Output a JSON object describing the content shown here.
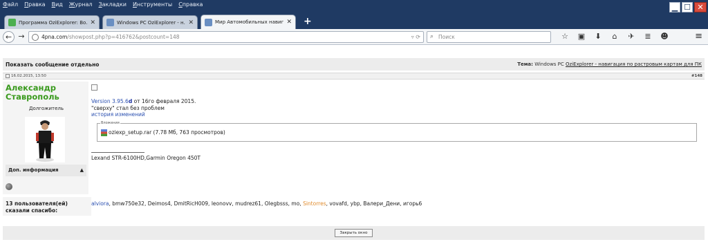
{
  "menubar": {
    "items": [
      "Файл",
      "Правка",
      "Вид",
      "Журнал",
      "Закладки",
      "Инструменты",
      "Справка"
    ]
  },
  "window_controls": {
    "minimize": "▁",
    "maximize": "☐",
    "close": "✕"
  },
  "tabs": [
    {
      "label": "Программа OziExplorer: Во...",
      "favicon_color": "#4caf50",
      "active": false
    },
    {
      "label": "Windows PC OziExplorer - н...",
      "favicon_color": "#6a8fc2",
      "active": false
    },
    {
      "label": "Мир Автомобильных навига...",
      "favicon_color": "#6a8fc2",
      "active": true
    }
  ],
  "new_tab": "+",
  "tab_close": "✕",
  "navbar": {
    "back": "←",
    "forward": "→",
    "url_host": "4pna.com",
    "url_path": "/showpost.php?p=416762&postcount=148",
    "url_icons": "▿  ⟳",
    "search_placeholder": "Поиск",
    "search_icon": "search-icon",
    "tool_icons": [
      "☆",
      "▣",
      "⬇",
      "⌂",
      "✈",
      "≣",
      "☻"
    ],
    "menu_icon": "≡"
  },
  "page": {
    "show_title": "Показать сообщение отдельно",
    "topic_label": "Тема:",
    "topic_prefix": "Windows PC",
    "topic_link": "OziExplorer - навигация по растровым картам для ПК",
    "post_date": "16.02.2015, 13:50",
    "post_number": "#148",
    "user": {
      "name": "Александр Ставрополь",
      "title": "Долгожитель",
      "add_info": "Доп. информация",
      "add_info_toggle": "▲"
    },
    "post": {
      "version_link": "Version 3.95.6",
      "version_letter": "d",
      "version_rest": " от 16го февраля 2015.",
      "line2": "\"сверху\" стал без проблем",
      "changes_link": "история изменений",
      "attachments_legend": "Вложения",
      "attachment_name": "oziexp_setup.rar",
      "attachment_meta": " (7.78 Мб, 763 просмотров)",
      "signature": "Lexand STR-6100HD,Garmin Oregon 450T"
    },
    "thanks": {
      "label_line1": "13 пользователя(ей)",
      "label_line2": "сказали спасибо:",
      "users": [
        {
          "name": "alviora",
          "style": "blue"
        },
        {
          "name": "bmw750e32",
          "style": "plain"
        },
        {
          "name": "Deimos4",
          "style": "plain"
        },
        {
          "name": "DmitRicH009",
          "style": "plain"
        },
        {
          "name": "leonovv",
          "style": "plain"
        },
        {
          "name": "mudrez61",
          "style": "plain"
        },
        {
          "name": "Olegbsss",
          "style": "plain"
        },
        {
          "name": "mo",
          "style": "plain"
        },
        {
          "name": "Sintorres",
          "style": "orange"
        },
        {
          "name": "vovafd",
          "style": "plain"
        },
        {
          "name": "ybp",
          "style": "plain"
        },
        {
          "name": "Валери_Дени",
          "style": "plain"
        },
        {
          "name": "игорь6",
          "style": "plain"
        }
      ]
    },
    "close_window": "Закрыть окно"
  }
}
